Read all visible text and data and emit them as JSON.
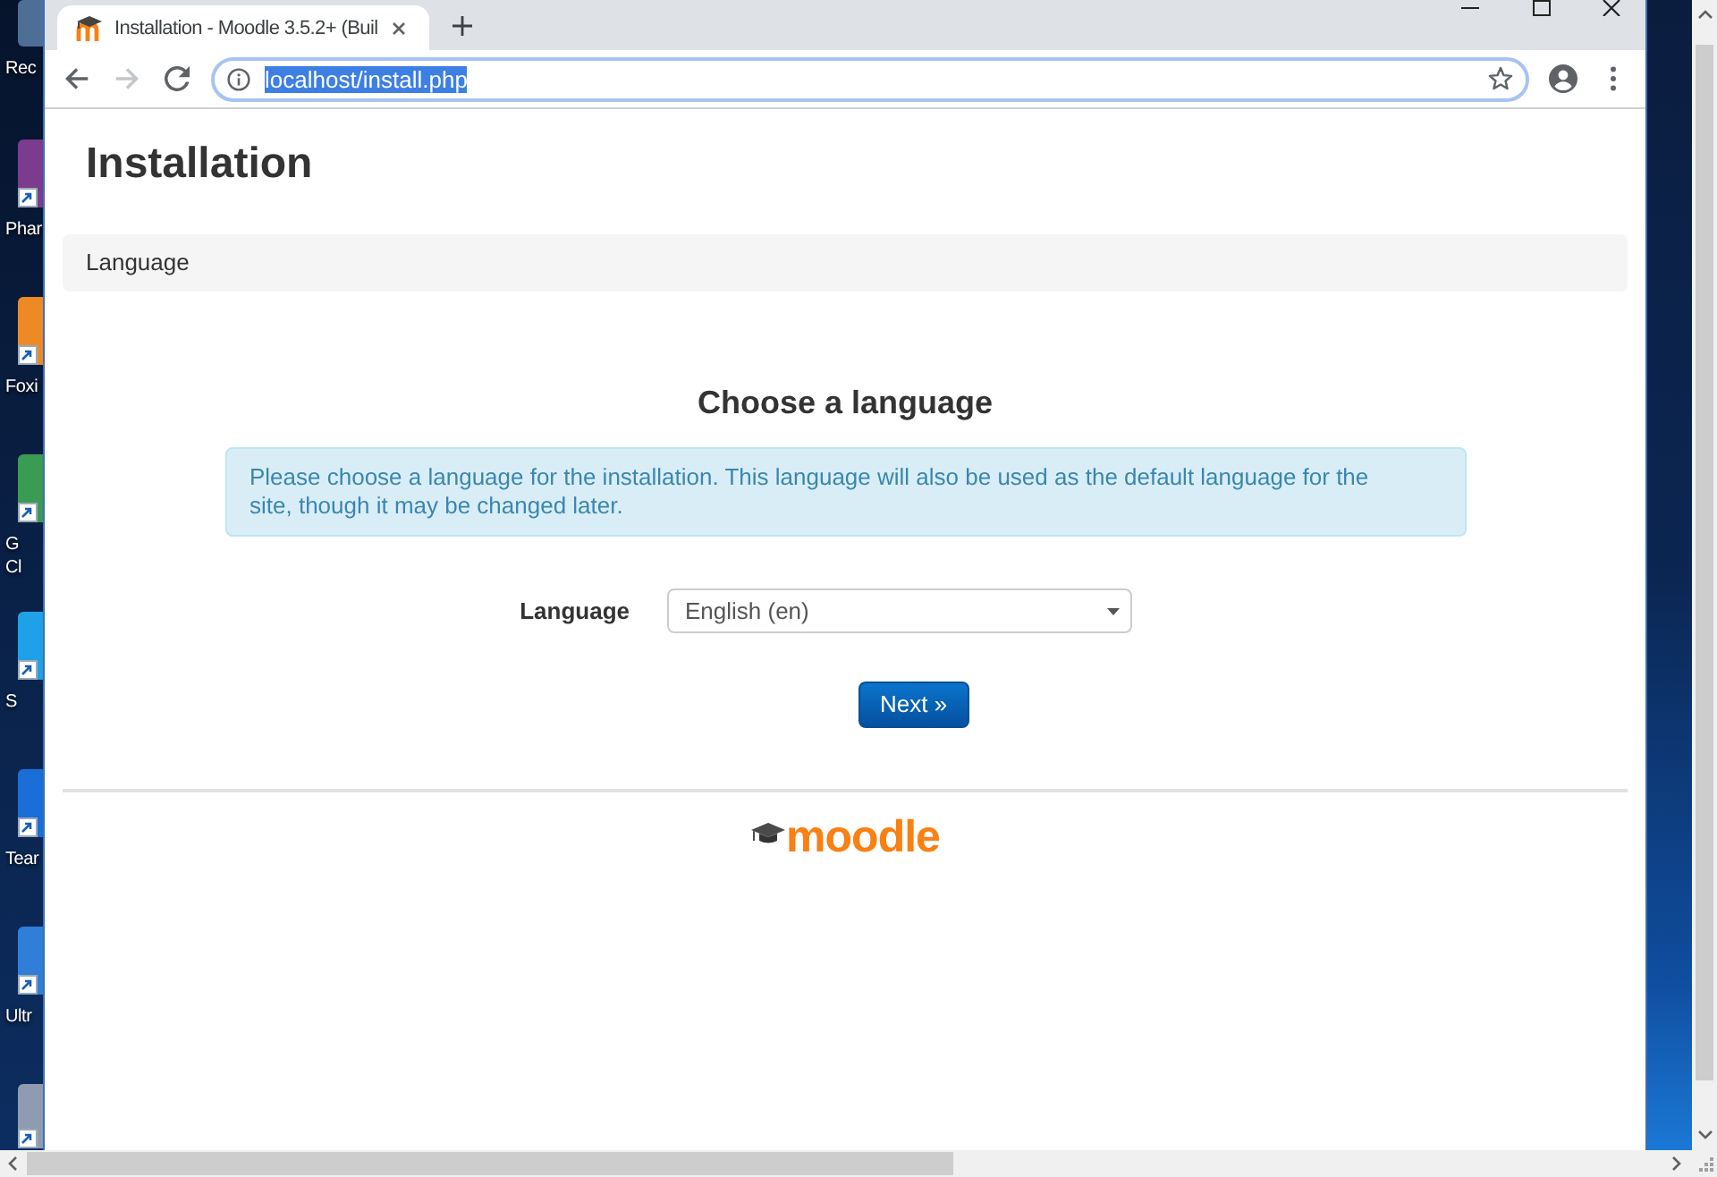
{
  "desktop": {
    "icons": [
      {
        "label": "Rec",
        "color": "#4d6f96",
        "shortcut": false
      },
      {
        "label": "Phar",
        "color": "#7b3c8e",
        "shortcut": true
      },
      {
        "label": "Foxi",
        "color": "#ee8a25",
        "shortcut": true
      },
      {
        "label": "G\nCl",
        "color": "#3a9b52",
        "shortcut": true
      },
      {
        "label": "S",
        "color": "#1ea1e6",
        "shortcut": true
      },
      {
        "label": "Tear",
        "color": "#1a6ed8",
        "shortcut": true
      },
      {
        "label": "Ultr",
        "color": "#2f7fd8",
        "shortcut": true
      },
      {
        "color": "#8f9bb0",
        "shortcut": true
      }
    ]
  },
  "browser": {
    "tabs": [
      {
        "title": "Installation - Moodle 3.5.2+ (Buil",
        "selected": true
      }
    ],
    "navigation": {
      "back_disabled": false,
      "forward_disabled": true
    },
    "address_bar": {
      "url": "localhost/install.php",
      "focused": true,
      "url_selected": true
    }
  },
  "page": {
    "title": "Installation",
    "breadcrumb": [
      {
        "label": "Language"
      }
    ],
    "heading": "Choose a language",
    "notice": "Please choose a language for the installation. This language will also be used as the default language for the site, though it may be changed later.",
    "form": {
      "fields": [
        {
          "kind": "select",
          "label": "Language",
          "value": "English (en)"
        }
      ],
      "submit": "Next »"
    },
    "footer": {
      "logo_text": "moodle"
    }
  }
}
